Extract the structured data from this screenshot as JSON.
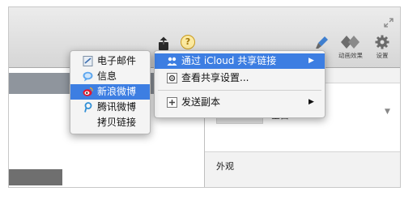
{
  "toolbar": {
    "help_label": "?",
    "tools": [
      {
        "name": "style",
        "label": "式",
        "icon": "paintbrush-icon"
      },
      {
        "name": "animate",
        "label": "动画效果",
        "icon": "diamond-animate-icon"
      },
      {
        "name": "setup",
        "label": "设置",
        "icon": "gear-icon"
      }
    ]
  },
  "share_menu": {
    "items": [
      {
        "label": "通过 iCloud 共享链接",
        "icon": "people-icon",
        "has_submenu": true,
        "highlighted": true
      },
      {
        "label": "查看共享设置...",
        "icon": "gear-square-icon",
        "has_submenu": false,
        "highlighted": false
      },
      {
        "label": "发送副本",
        "icon": "plus-square-icon",
        "has_submenu": true,
        "highlighted": false
      }
    ]
  },
  "submenu": {
    "items": [
      {
        "label": "电子邮件",
        "icon": "mail-icon",
        "highlighted": false
      },
      {
        "label": "信息",
        "icon": "messages-icon",
        "highlighted": false
      },
      {
        "label": "新浪微博",
        "icon": "weibo-icon",
        "highlighted": true
      },
      {
        "label": "腾讯微博",
        "icon": "tencent-weibo-icon",
        "highlighted": false
      },
      {
        "label": "拷贝链接",
        "icon": "",
        "highlighted": false
      }
    ]
  },
  "inspector": {
    "background_label": "空白",
    "appearance_label": "外观"
  },
  "colors": {
    "highlight": "#3d7ee2",
    "menu_bg": "#f4f4f4"
  }
}
